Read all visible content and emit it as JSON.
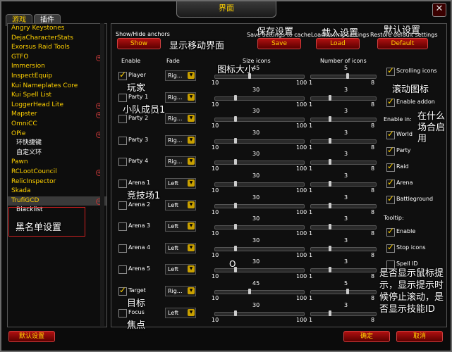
{
  "window": {
    "title": "界面",
    "close_icon": "close-icon"
  },
  "tabs": [
    {
      "label": "游戏"
    },
    {
      "label": "插件"
    }
  ],
  "sidebar": {
    "items": [
      {
        "label": "Angry Keystones",
        "plus": false
      },
      {
        "label": "DejaCharacterStats",
        "plus": false
      },
      {
        "label": "Exorsus Raid Tools",
        "plus": false
      },
      {
        "label": "GTFO",
        "plus": true
      },
      {
        "label": "Immersion",
        "plus": false
      },
      {
        "label": "InspectEquip",
        "plus": false
      },
      {
        "label": "Kui Nameplates Core",
        "plus": false
      },
      {
        "label": "Kui Spell List",
        "plus": false
      },
      {
        "label": "LoggerHead Lite",
        "plus": true
      },
      {
        "label": "Mapster",
        "plus": true
      },
      {
        "label": "OmniCC",
        "plus": false
      },
      {
        "label": "OPie",
        "plus": true
      },
      {
        "label": "环快捷键",
        "plus": false,
        "sub": true
      },
      {
        "label": "自定义环",
        "plus": false,
        "sub": true
      },
      {
        "label": "Pawn",
        "plus": false
      },
      {
        "label": "RCLootCouncil",
        "plus": true
      },
      {
        "label": "RelicInspector",
        "plus": false
      },
      {
        "label": "Skada",
        "plus": false
      },
      {
        "label": "TrufiGCD",
        "plus": true,
        "selected": true
      },
      {
        "label": "Blacklist",
        "plus": false,
        "sub": true
      }
    ],
    "annotation": "黑名单设置"
  },
  "header": {
    "show_hide_label": "Show/Hide anchors",
    "show_button": "Show",
    "save_caption": "Save settings to cache",
    "save_button": "Save",
    "load_caption": "Load saving settings",
    "load_button": "Load",
    "restore_caption": "Restore default settings",
    "default_button": "Default",
    "ann_show": "显示移动界面",
    "ann_save": "保存设置",
    "ann_load": "载入设置",
    "ann_default": "默认设置"
  },
  "columns": {
    "enable": "Enable",
    "fade": "Fade",
    "size": "Size icons",
    "count": "Number of icons",
    "ann_size": "图标大小"
  },
  "rows": [
    {
      "label": "Player",
      "checked": true,
      "fade": "Rig...",
      "size": 45,
      "count": 5,
      "ann": "玩家"
    },
    {
      "label": "Party 1",
      "checked": false,
      "fade": "Rig...",
      "size": 30,
      "count": 3,
      "ann": "小队成员1"
    },
    {
      "label": "Party 2",
      "checked": false,
      "fade": "Rig...",
      "size": 30,
      "count": 3,
      "ann": ""
    },
    {
      "label": "Party 3",
      "checked": false,
      "fade": "Rig...",
      "size": 30,
      "count": 3,
      "ann": ""
    },
    {
      "label": "Party 4",
      "checked": false,
      "fade": "Rig...",
      "size": 30,
      "count": 3,
      "ann": ""
    },
    {
      "label": "Arena 1",
      "checked": false,
      "fade": "Left",
      "size": 30,
      "count": 3,
      "ann": "竞技场1"
    },
    {
      "label": "Arena 2",
      "checked": false,
      "fade": "Left",
      "size": 30,
      "count": 3,
      "ann": ""
    },
    {
      "label": "Arena 3",
      "checked": false,
      "fade": "Left",
      "size": 30,
      "count": 3,
      "ann": ""
    },
    {
      "label": "Arena 4",
      "checked": false,
      "fade": "Left",
      "size": 30,
      "count": 3,
      "ann": ""
    },
    {
      "label": "Arena 5",
      "checked": false,
      "fade": "Left",
      "size": 30,
      "count": 3,
      "ann": ""
    },
    {
      "label": "Target",
      "checked": true,
      "fade": "Rig...",
      "size": 45,
      "count": 5,
      "ann": "目标"
    },
    {
      "label": "Focus",
      "checked": false,
      "fade": "Left",
      "size": 30,
      "count": 3,
      "ann": "焦点"
    }
  ],
  "slider_range": {
    "size_min": "10",
    "size_max": "100",
    "count_min": "1",
    "count_max": "8",
    "marker": "O"
  },
  "right": {
    "scrolling_icons": "Scrolling icons",
    "enable_addon": "Enable addon",
    "enable_in": "Enable in:",
    "world": "World",
    "party": "Party",
    "raid": "Raid",
    "arena": "Arena",
    "battleground": "Battleground",
    "tooltip": "Tooltip:",
    "tt_enable": "Enable",
    "stop_icons": "Stop icons",
    "spell_id": "Spell ID",
    "ann_scroll": "滚动图标",
    "ann_where": "在什么场合启用",
    "ann_tooltip": "是否显示鼠标提示，显示提示时候停止滚动，是否显示技能ID"
  },
  "footer": {
    "defaults": "默认设置",
    "ok": "确定",
    "cancel": "取消"
  }
}
